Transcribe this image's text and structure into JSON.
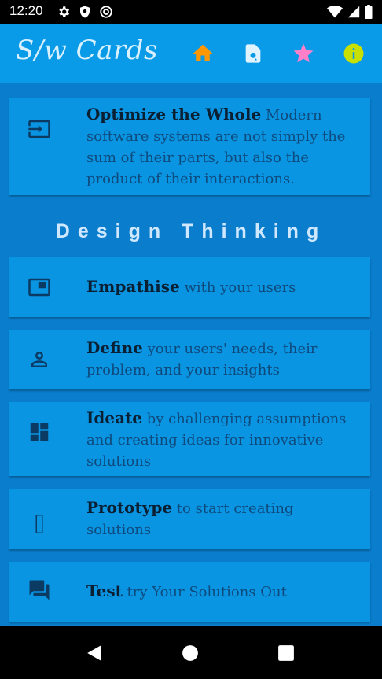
{
  "status": {
    "time": "12:20"
  },
  "app": {
    "title": "S/w Cards",
    "actions": [
      {
        "icon": "home-icon",
        "color": "#ff9800"
      },
      {
        "icon": "search-document-icon",
        "color": "#e0f4ff"
      },
      {
        "icon": "star-icon",
        "color": "#ff80c8"
      },
      {
        "icon": "info-icon",
        "color": "#c8e000"
      }
    ]
  },
  "cards": [
    {
      "icon": "input-icon",
      "heading": "Optimize the Whole",
      "text": "Modern software systems are not simply the sum of their parts, but also the product of their interactions."
    }
  ],
  "section": {
    "title": "Design Thinking"
  },
  "design_cards": [
    {
      "icon": "picture-in-picture-icon",
      "heading": "Empathise",
      "text": "with your users"
    },
    {
      "icon": "person-icon",
      "heading": "Define",
      "text": "your users' needs, their problem, and your insights"
    },
    {
      "icon": "dashboard-icon",
      "heading": "Ideate",
      "text": "by challenging assumptions and creating ideas for innovative solutions"
    },
    {
      "icon": "missing-glyph-icon",
      "heading": "Prototype",
      "text": "to start creating solutions"
    },
    {
      "icon": "chat-icon",
      "heading": "Test",
      "text": "try Your Solutions Out"
    }
  ],
  "colors": {
    "app_bar": "#0a9be8",
    "content_bg": "#0a7dcc",
    "card_bg": "#0a95e3",
    "heading_text": "#0b1f33",
    "body_text": "#0f4a7c"
  }
}
